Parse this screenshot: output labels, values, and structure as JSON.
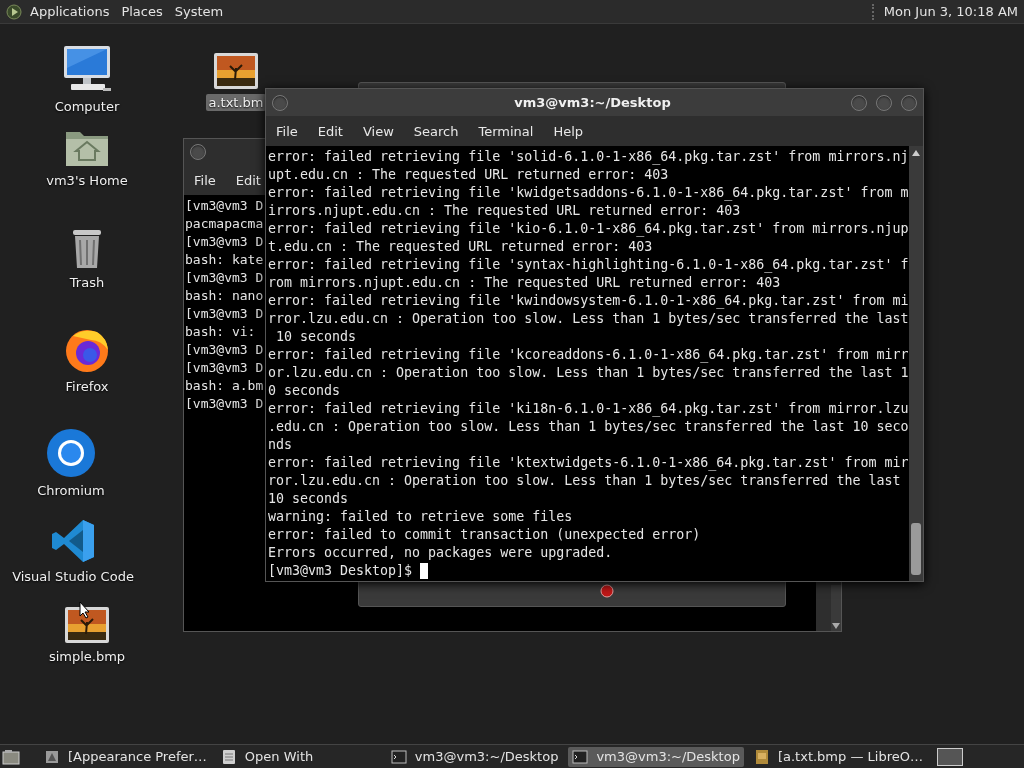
{
  "top_panel": {
    "menus": [
      "Applications",
      "Places",
      "System"
    ],
    "clock": "Mon Jun  3, 10:18 AM"
  },
  "desktop_icons": [
    {
      "label": "Computer",
      "kind": "computer",
      "selected": false
    },
    {
      "label": "vm3's Home",
      "kind": "home",
      "selected": false
    },
    {
      "label": "Trash",
      "kind": "trash",
      "selected": false
    },
    {
      "label": "Firefox",
      "kind": "firefox",
      "selected": false
    },
    {
      "label": "Chromium",
      "kind": "chromium",
      "selected": false
    },
    {
      "label": "Visual Studio Code",
      "kind": "vscode",
      "selected": false
    },
    {
      "label": "simple.bmp",
      "kind": "image",
      "selected": false
    },
    {
      "label": "a.txt.bm",
      "kind": "image",
      "selected": true
    }
  ],
  "back_terminal": {
    "menu": [
      "File",
      "Edit"
    ],
    "lines": [
      "[vm3@vm3 D",
      "pacmapacma",
      "[vm3@vm3 D",
      "bash: kate",
      "[vm3@vm3 D",
      "bash: nano",
      "[vm3@vm3 D",
      "bash: vi:",
      "[vm3@vm3 D",
      "[vm3@vm3 D",
      "bash: a.bm",
      "[vm3@vm3 D"
    ]
  },
  "terminal": {
    "title": "vm3@vm3:~/Desktop",
    "menu": [
      "File",
      "Edit",
      "View",
      "Search",
      "Terminal",
      "Help"
    ],
    "lines": [
      "error: failed retrieving file 'solid-6.1.0-1-x86_64.pkg.tar.zst' from mirrors.nj",
      "upt.edu.cn : The requested URL returned error: 403",
      "error: failed retrieving file 'kwidgetsaddons-6.1.0-1-x86_64.pkg.tar.zst' from m",
      "irrors.njupt.edu.cn : The requested URL returned error: 403",
      "error: failed retrieving file 'kio-6.1.0-1-x86_64.pkg.tar.zst' from mirrors.njup",
      "t.edu.cn : The requested URL returned error: 403",
      "error: failed retrieving file 'syntax-highlighting-6.1.0-1-x86_64.pkg.tar.zst' f",
      "rom mirrors.njupt.edu.cn : The requested URL returned error: 403",
      "error: failed retrieving file 'kwindowsystem-6.1.0-1-x86_64.pkg.tar.zst' from mi",
      "rror.lzu.edu.cn : Operation too slow. Less than 1 bytes/sec transferred the last",
      " 10 seconds",
      "error: failed retrieving file 'kcoreaddons-6.1.0-1-x86_64.pkg.tar.zst' from mirr",
      "or.lzu.edu.cn : Operation too slow. Less than 1 bytes/sec transferred the last 1",
      "0 seconds",
      "error: failed retrieving file 'ki18n-6.1.0-1-x86_64.pkg.tar.zst' from mirror.lzu",
      ".edu.cn : Operation too slow. Less than 1 bytes/sec transferred the last 10 seco",
      "nds",
      "error: failed retrieving file 'ktextwidgets-6.1.0-1-x86_64.pkg.tar.zst' from mir",
      "ror.lzu.edu.cn : Operation too slow. Less than 1 bytes/sec transferred the last ",
      "10 seconds",
      "warning: failed to retrieve some files",
      "error: failed to commit transaction (unexpected error)",
      "Errors occurred, no packages were upgraded."
    ],
    "prompt": "[vm3@vm3 Desktop]$"
  },
  "taskbar": {
    "items": [
      {
        "label": "[Appearance Prefer…",
        "kind": "prefs",
        "selected": false
      },
      {
        "label": "Open With",
        "kind": "dialog",
        "selected": false
      },
      {
        "label": "vm3@vm3:~/Desktop",
        "kind": "terminal",
        "selected": false
      },
      {
        "label": "vm3@vm3:~/Desktop",
        "kind": "terminal",
        "selected": true
      },
      {
        "label": "[a.txt.bmp — LibreO…",
        "kind": "document",
        "selected": false
      }
    ]
  }
}
